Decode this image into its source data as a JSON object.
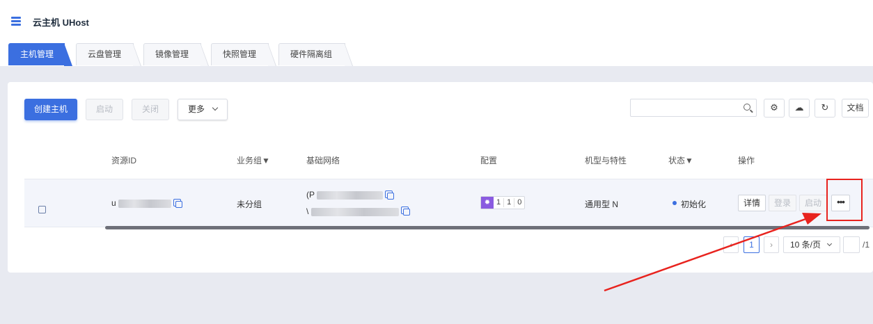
{
  "app": {
    "title": "云主机 UHost"
  },
  "tabs": [
    {
      "label": "主机管理",
      "active": true
    },
    {
      "label": "云盘管理"
    },
    {
      "label": "镜像管理"
    },
    {
      "label": "快照管理"
    },
    {
      "label": "硬件隔离组"
    }
  ],
  "toolbar": {
    "create_label": "创建主机",
    "start_label": "启动",
    "stop_label": "关闭",
    "more_label": "更多",
    "docs_label": "文档",
    "search_placeholder": ""
  },
  "table": {
    "headers": [
      "资源ID",
      "业务组▼",
      "基础网络",
      "配置",
      "机型与特性",
      "状态▼",
      "操作"
    ],
    "rows": [
      {
        "resource_id_prefix": "u",
        "group": "未分组",
        "network_line1_prefix": "(P",
        "network_line2_prefix": "\\",
        "config_icon": "gear-icon",
        "config_values": [
          "1",
          "1",
          "0"
        ],
        "model": "通用型 N",
        "status": "初始化",
        "status_color": "#3b6fe0",
        "actions": {
          "detail": "详情",
          "login": "登录",
          "start": "启动",
          "more": "•••"
        }
      }
    ]
  },
  "pagination": {
    "current": "1",
    "page_size": "10 条/页",
    "total": "/1"
  },
  "colors": {
    "accent": "#3b6fe0",
    "annotation": "#e8231e",
    "config_badge": "#8a5be0"
  }
}
